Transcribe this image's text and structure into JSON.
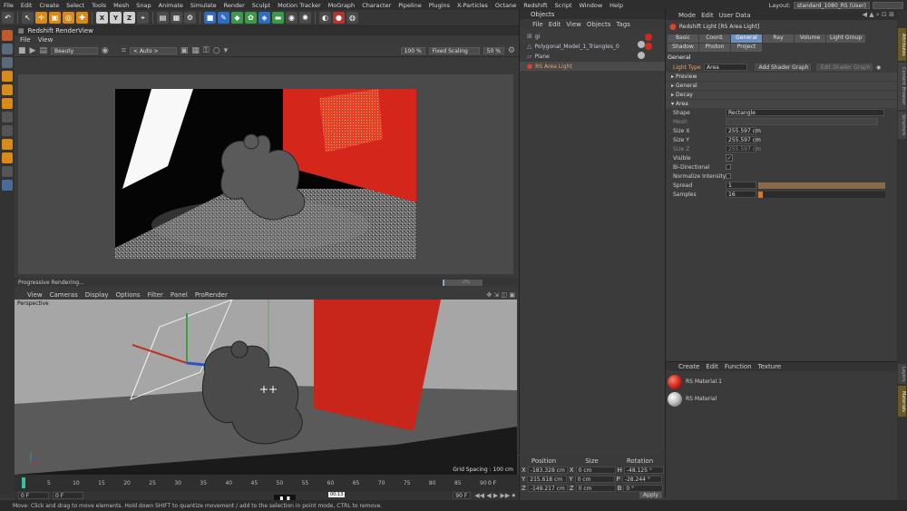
{
  "menubar": {
    "items": [
      "File",
      "Edit",
      "Create",
      "Select",
      "Tools",
      "Mesh",
      "Snap",
      "Animate",
      "Simulate",
      "Render",
      "Sculpt",
      "Motion Tracker",
      "MoGraph",
      "Character",
      "Pipeline",
      "Plugins",
      "X-Particles",
      "Octane",
      "Redshift",
      "Script",
      "Window",
      "Help"
    ],
    "layout_label": "Layout:",
    "layout_value": "standard_1080_RS (User)"
  },
  "toolbar": {
    "axis_x": "X",
    "axis_y": "Y",
    "axis_z": "Z"
  },
  "renderview": {
    "title": "Redshift RenderView",
    "menu": [
      "File",
      "View"
    ],
    "aov": "Beauty",
    "camera": "< Auto >",
    "zoom": "100 %",
    "scaling": "Fixed Scaling",
    "zoom2": "50 %",
    "status": "Progressive Rendering...",
    "progress_label": "2%",
    "progress": 0.05
  },
  "viewport": {
    "menu": [
      "View",
      "Cameras",
      "Display",
      "Options",
      "Filter",
      "Panel",
      "ProRender"
    ],
    "label": "Perspective",
    "grid": "Grid Spacing : 100 cm"
  },
  "timeline": {
    "ticks": [
      "0",
      "5",
      "10",
      "15",
      "20",
      "25",
      "30",
      "35",
      "40",
      "45",
      "50",
      "55",
      "60",
      "65",
      "70",
      "75",
      "80",
      "85",
      "90"
    ],
    "end": "0 F",
    "current": "0 F",
    "field2": "0 F",
    "field3": "90 F",
    "video_time": "00:13"
  },
  "status_text": "Move: Click and drag to move elements. Hold down SHIFT to quantize movement / add to the selection in point mode, CTRL to remove.",
  "objects": {
    "title": "Objects",
    "menu": [
      "File",
      "Edit",
      "View",
      "Objects",
      "Tags"
    ],
    "rows": [
      {
        "name": "gi"
      },
      {
        "name": "Polygonal_Model_1_Triangles_0"
      },
      {
        "name": "Plane"
      },
      {
        "name": "RS Area Light"
      }
    ]
  },
  "coordinates": {
    "headers": [
      "Position",
      "Size",
      "Rotation"
    ],
    "rows": [
      {
        "axis": "X",
        "pos": "-183.328 cm",
        "size_axis": "X",
        "size": "0 cm",
        "rot_axis": "H",
        "rot": "-48.125 °"
      },
      {
        "axis": "Y",
        "pos": "215.618 cm",
        "size_axis": "Y",
        "size": "0 cm",
        "rot_axis": "P",
        "rot": "-28.244 °"
      },
      {
        "axis": "Z",
        "pos": "-149.217 cm",
        "size_axis": "Z",
        "size": "0 cm",
        "rot_axis": "B",
        "rot": "0 °"
      }
    ],
    "apply": "Apply"
  },
  "attributes": {
    "menu": [
      "Mode",
      "Edit",
      "User Data"
    ],
    "object_title": "Redshift Light [RS Area Light]",
    "tabs_row1": [
      "Basic",
      "Coord.",
      "General",
      "Ray",
      "Volume",
      "Light Group"
    ],
    "tabs_row2": [
      "Shadow",
      "Photon",
      "Project"
    ],
    "active_tab": "General",
    "section_general": "General",
    "light_type_label": "Light Type",
    "light_type_value": "Area",
    "add_graph": "Add Shader Graph",
    "edit_graph": "Edit Shader Graph",
    "groups": [
      "Preview",
      "General",
      "Decay",
      "Area"
    ],
    "params": [
      {
        "label": "Shape",
        "value": "Rectangle"
      },
      {
        "label": "Mesh",
        "value": ""
      },
      {
        "label": "Size X",
        "value": "255.597 cm"
      },
      {
        "label": "Size Y",
        "value": "255.597 cm"
      },
      {
        "label": "Size Z",
        "value": "255.597 cm"
      },
      {
        "label": "Visible",
        "value": "✓"
      },
      {
        "label": "Bi-Directional",
        "value": ""
      },
      {
        "label": "Normalize Intensity",
        "value": ""
      },
      {
        "label": "Spread",
        "value": "1"
      },
      {
        "label": "Samples",
        "value": "16"
      }
    ]
  },
  "materials": {
    "menu": [
      "Create",
      "Edit",
      "Function",
      "Texture"
    ],
    "items": [
      {
        "name": "RS Material.1",
        "color": "#d02a1c"
      },
      {
        "name": "RS Material",
        "color": "#b8b8b8"
      }
    ]
  },
  "right_tabs": [
    "Attributes",
    "Content Browser",
    "Structure",
    "Layers",
    "Materials"
  ],
  "colors": {
    "accent": "#6a8fc0",
    "red_plane": "#c8261a",
    "orange": "#d98a1a"
  }
}
